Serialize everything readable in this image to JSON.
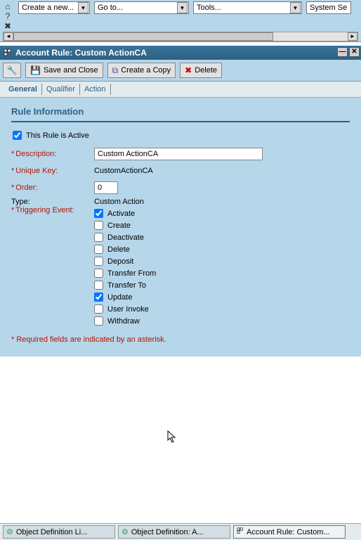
{
  "toolbar": {
    "combos": {
      "create": "Create a new...",
      "goto": "Go to...",
      "tools": "Tools...",
      "system": "System Se"
    }
  },
  "window": {
    "title": "Account Rule: Custom ActionCA"
  },
  "actions": {
    "save_and_close": "Save and Close",
    "create_copy": "Create a Copy",
    "delete": "Delete"
  },
  "tabs": {
    "general": "General",
    "qualifier": "Qualifier",
    "action": "Action"
  },
  "section": {
    "heading": "Rule Information",
    "active_label": "This Rule is Active",
    "active_checked": true,
    "description_label": "Description:",
    "description_value": "Custom ActionCA",
    "unique_key_label": "Unique Key:",
    "unique_key_value": "CustomActionCA",
    "order_label": "Order:",
    "order_value": "0",
    "type_label": "Type:",
    "type_value": "Custom Action",
    "trigger_label": "Triggering Event:",
    "events": [
      {
        "label": "Activate",
        "checked": true
      },
      {
        "label": "Create",
        "checked": false
      },
      {
        "label": "Deactivate",
        "checked": false
      },
      {
        "label": "Delete",
        "checked": false
      },
      {
        "label": "Deposit",
        "checked": false
      },
      {
        "label": "Transfer From",
        "checked": false
      },
      {
        "label": "Transfer To",
        "checked": false
      },
      {
        "label": "Update",
        "checked": true
      },
      {
        "label": "User Invoke",
        "checked": false
      },
      {
        "label": "Withdraw",
        "checked": false
      }
    ],
    "footnote": "Required fields are indicated by an asterisk."
  },
  "taskbar": {
    "items": [
      "Object Definition Li...",
      "Object Definition: A...",
      "Account Rule: Custom..."
    ]
  }
}
